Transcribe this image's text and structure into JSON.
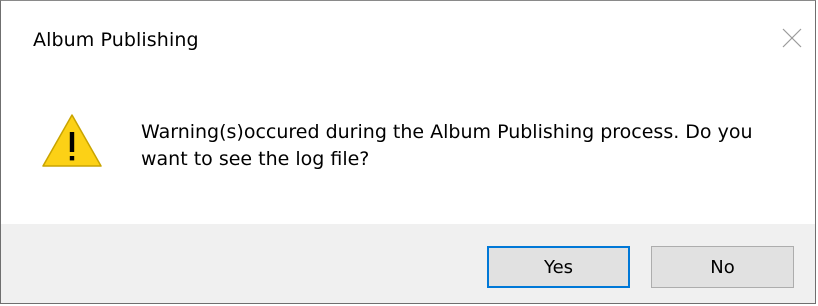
{
  "dialog": {
    "title": "Album Publishing",
    "message": "Warning(s)occured during the Album Publishing process. Do you want to see the log file?",
    "icon": "warning-icon",
    "buttons": {
      "yes_label": "Yes",
      "no_label": "No"
    },
    "default_button": "yes"
  },
  "colors": {
    "accent": "#0078d7",
    "warning_fill": "#fcd116",
    "footer_bg": "#f0f0f0",
    "button_bg": "#e1e1e1"
  }
}
